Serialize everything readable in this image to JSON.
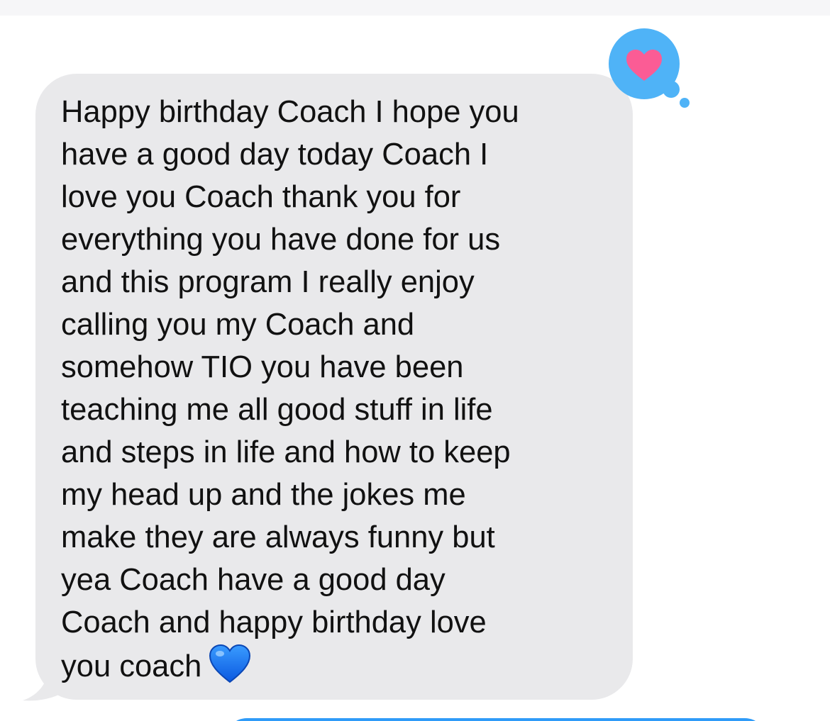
{
  "conversation": {
    "incoming_message": {
      "text": "Happy birthday Coach I hope you\nhave a good day today Coach I\nlove you Coach thank you for\neverything you have done for us\nand this program I really enjoy\ncalling you my Coach and\nsomehow TIO you have been\nteaching me all good stuff in life\nand steps in life and how to keep\nmy head up and the jokes me\nmake they are always funny but\nyea Coach have a good day\nCoach and happy birthday love\nyou coach",
      "trailing_emoji": "blue-heart-icon",
      "bubble_color": "#e9e9eb",
      "text_color": "#111111"
    },
    "tapback_reaction": {
      "icon": "heart-icon",
      "badge_color": "#4fb3f7",
      "heart_color": "#fb5c95"
    },
    "outgoing_message_partial": {
      "bubble_color": "#2f9bf8"
    }
  }
}
